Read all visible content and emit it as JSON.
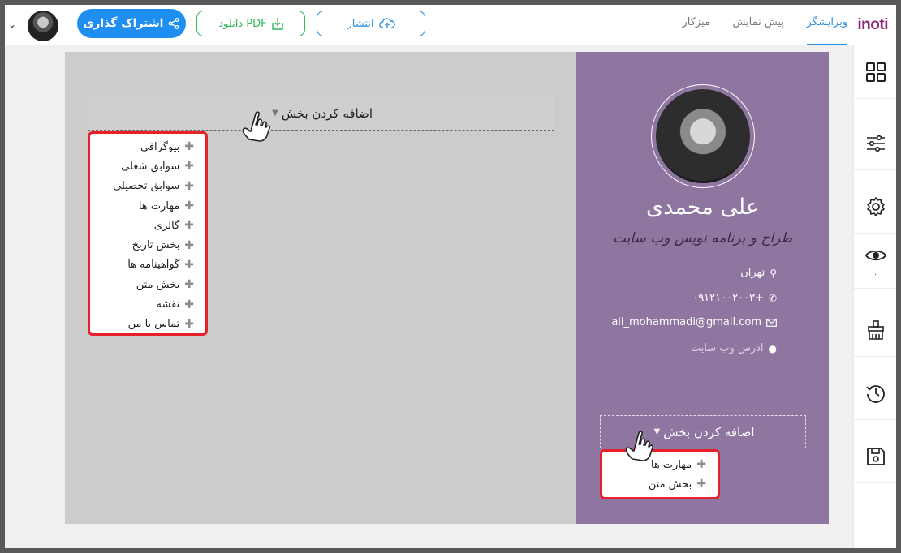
{
  "app": {
    "logo": "inoti",
    "tabs": [
      {
        "label": "ویرایشگر",
        "active": true
      },
      {
        "label": "پیش نمایش",
        "active": false
      },
      {
        "label": "میزکار",
        "active": false
      }
    ]
  },
  "toolbar": {
    "publish_label": "انتشار",
    "pdf_label": "دانلود PDF",
    "share_label": "اشتراک گذاری"
  },
  "sidebar": {
    "items": [
      {
        "icon": "grid-icon"
      },
      {
        "icon": "sliders-icon"
      },
      {
        "icon": "gear-icon"
      },
      {
        "icon": "eye-icon",
        "count": "۰"
      },
      {
        "icon": "brush-icon"
      },
      {
        "icon": "history-icon"
      },
      {
        "icon": "save-icon"
      }
    ]
  },
  "profile": {
    "name": "علی محمدی",
    "job_title": "طراح و برنامه نویس وب سایت",
    "city": "تهران",
    "phone": "+۰۹۱۲۱۰۰۲۰۰۳",
    "email": "ali_mohammadi@gmail.com",
    "website": "ادرس وب سایت"
  },
  "main_add_section": {
    "label": "اضافه کردن بخش",
    "options": [
      "بیوگرافی",
      "سوابق شغلی",
      "سوابق تحصیلی",
      "مهارت ها",
      "گالری",
      "بخش تاریخ",
      "گواهینامه ها",
      "بخش متن",
      "نقشه",
      "تماس با من"
    ]
  },
  "side_add_section": {
    "label": "اضافه کردن بخش",
    "options": [
      "مهارت ها",
      "بخش متن"
    ]
  },
  "colors": {
    "accent": "#1e8ff0",
    "pdf": "#2fb65a",
    "profile_bg": "#8f76a0",
    "highlight": "#e8202a"
  }
}
